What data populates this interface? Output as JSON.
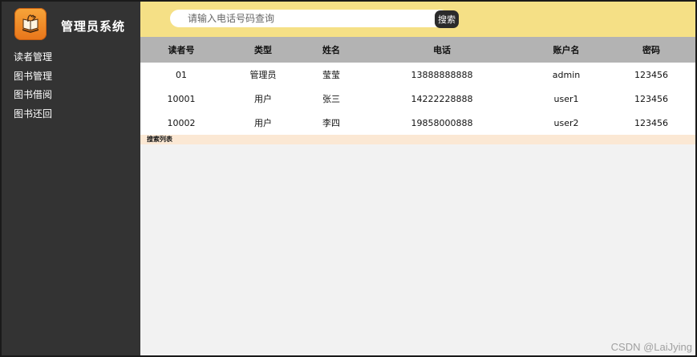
{
  "app": {
    "title": "管理员系统",
    "logo_icon": "book-hand-icon",
    "accent": "#f0901e"
  },
  "sidebar": {
    "items": [
      {
        "label": "读者管理"
      },
      {
        "label": "图书管理"
      },
      {
        "label": "图书借阅"
      },
      {
        "label": "图书还回"
      }
    ]
  },
  "search": {
    "placeholder": "请输入电话号码查询",
    "value": "",
    "button_label": "搜索"
  },
  "table": {
    "columns": [
      "读者号",
      "类型",
      "姓名",
      "电话",
      "账户名",
      "密码"
    ],
    "rows": [
      [
        "01",
        "管理员",
        "莹莹",
        "13888888888",
        "admin",
        "123456"
      ],
      [
        "10001",
        "用户",
        "张三",
        "14222228888",
        "user1",
        "123456"
      ],
      [
        "10002",
        "用户",
        "李四",
        "19858000888",
        "user2",
        "123456"
      ]
    ],
    "caption": "搜索列表"
  },
  "watermark": "CSDN @LaiJying",
  "colors": {
    "sidebar": "#333333",
    "topbar": "#f5e086",
    "header": "#b3b3b3",
    "caption_bar": "#fbe8d4"
  }
}
